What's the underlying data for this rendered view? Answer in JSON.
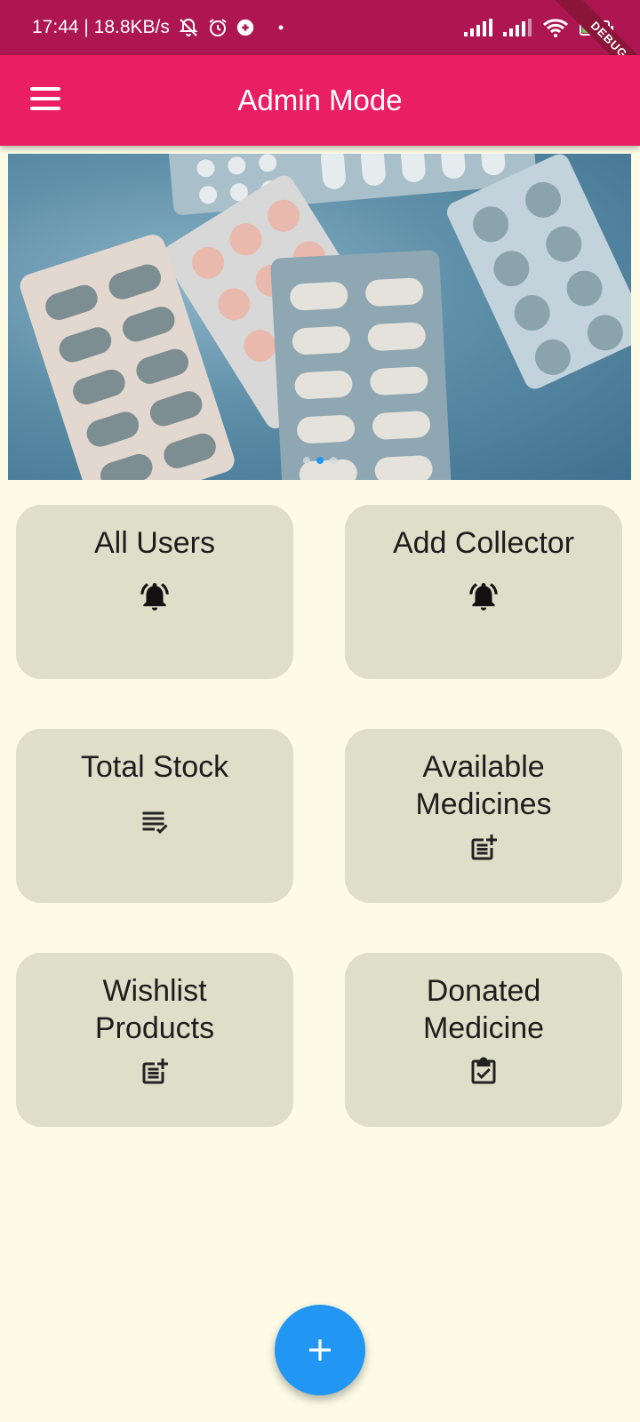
{
  "status_bar": {
    "time_speed": "17:44 | 18.8KB/s",
    "battery": "98",
    "debug_ribbon": "DEBUG"
  },
  "app_bar": {
    "title": "Admin Mode",
    "menu_icon": "hamburger-menu-icon"
  },
  "banner": {
    "slides": 3,
    "active_slide": 2
  },
  "cards": [
    {
      "label": "All Users",
      "icon": "notifications-active-icon"
    },
    {
      "label": "Add Collector",
      "icon": "notifications-active-icon"
    },
    {
      "label": "Total Stock",
      "icon": "checklist-icon"
    },
    {
      "label": "Available Medicines",
      "icon": "post-add-icon"
    },
    {
      "label": "Wishlist Products",
      "icon": "post-add-icon"
    },
    {
      "label": "Donated Medicine",
      "icon": "assignment-turned-in-icon"
    }
  ],
  "fab": {
    "icon": "plus-icon"
  },
  "colors": {
    "status_bar": "#ad1650",
    "app_bar": "#e91e63",
    "background": "#fdfbe6",
    "card": "#dfdfc9",
    "fab": "#2196f3"
  }
}
